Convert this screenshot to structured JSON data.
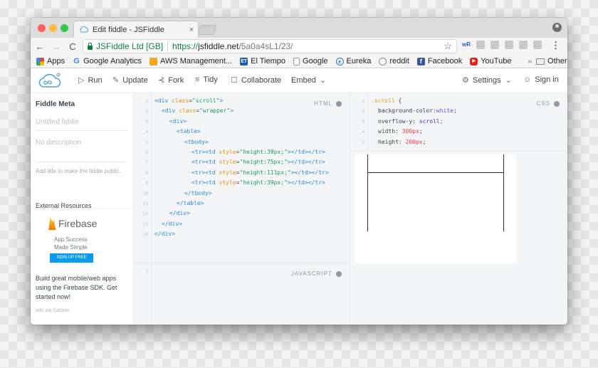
{
  "browser": {
    "tab_title": "Edit fiddle - JSFiddle",
    "tab_close": "×",
    "nav": {
      "back": "←",
      "forward": "→",
      "reload": "C"
    },
    "cert_label": "JSFiddle Ltd [GB]",
    "url": {
      "scheme": "https://",
      "host": "jsfiddle.net",
      "path": "/5a0a4sL1/23/"
    },
    "star": "☆",
    "menu": "⋮",
    "extensions": [
      "wR",
      "",
      "",
      "",
      "",
      ""
    ]
  },
  "bookmarks": [
    {
      "label": "Apps",
      "icon": "apps-icon"
    },
    {
      "label": "Google Analytics",
      "icon": "google-icon"
    },
    {
      "label": "AWS Management...",
      "icon": "aws-icon"
    },
    {
      "label": "El Tiempo",
      "icon": "el-tiempo-icon"
    },
    {
      "label": "Google",
      "icon": "document-icon"
    },
    {
      "label": "Eureka",
      "icon": "eureka-icon"
    },
    {
      "label": "reddit",
      "icon": "reddit-icon"
    },
    {
      "label": "Facebook",
      "icon": "facebook-icon"
    },
    {
      "label": "YouTube",
      "icon": "youtube-icon"
    }
  ],
  "bookmarks_overflow": "»",
  "other_bookmarks": "Other Bookmarks",
  "header": {
    "run": "Run",
    "update": "Update",
    "fork": "Fork",
    "tidy": "Tidy",
    "collaborate": "Collaborate",
    "embed": "Embed",
    "settings": "Settings",
    "sign_in": "Sign in"
  },
  "sidebar": {
    "title": "Fiddle Meta",
    "title_placeholder": "Untitled fiddle",
    "description_placeholder": "No description",
    "hint": "Add title to make the fiddle public.",
    "external_resources": "External Resources",
    "ad": {
      "brand": "Firebase",
      "tagline_1": "App Success",
      "tagline_2": "Made Simple",
      "cta": "SIGN UP FREE",
      "copy": "Build great mobile/web apps using the Firebase SDK. Get started now!",
      "via": "ads via Carbon"
    }
  },
  "editors": {
    "html": {
      "label": "HTML",
      "lines": [
        "1",
        "2",
        "3",
        "4",
        "5",
        "6",
        "7",
        "8",
        "9",
        "10",
        "11",
        "12",
        "13",
        "14"
      ]
    },
    "css": {
      "label": "CSS",
      "lines": [
        "1",
        "2",
        "3",
        "4",
        "5"
      ]
    },
    "js": {
      "label": "JAVASCRIPT",
      "lines": [
        "1"
      ]
    }
  },
  "code_html": {
    "l1": {
      "open": "<div ",
      "attr": "class",
      "eq": "=",
      "val": "\"scroll\"",
      "close": ">"
    },
    "l2": {
      "open": "<div ",
      "attr": "class",
      "eq": "=",
      "val": "\"wrapper\"",
      "close": ">"
    },
    "l3": "<div>",
    "l4": "<table>",
    "l5": "<tbody>",
    "rows": [
      {
        "pre": "<tr><td ",
        "attr": "style",
        "eq": "=",
        "val": "\"height:39px;\"",
        "post": "></td></tr>"
      },
      {
        "pre": "<tr><td ",
        "attr": "style",
        "eq": "=",
        "val": "\"height:75px;\"",
        "post": "></td></tr>"
      },
      {
        "pre": "<tr><td ",
        "attr": "style",
        "eq": "=",
        "val": "\"height:111px;\"",
        "post": "></td></tr>"
      },
      {
        "pre": "<tr><td ",
        "attr": "style",
        "eq": "=",
        "val": "\"height:39px;\"",
        "post": "></td></tr>"
      }
    ],
    "l10": "</tbody>",
    "l11": "</table>",
    "l12": "</div>",
    "l13": "</div>",
    "l14": "</div>"
  },
  "code_css": {
    "selector": ".scroll",
    "brace_open": " {",
    "p1": {
      "prop": "background-color:",
      "val": "white",
      "end": ";"
    },
    "p2": {
      "prop": "overflow-y: ",
      "val": "scroll",
      "end": ";"
    },
    "p3": {
      "prop": "width: ",
      "val": "300px",
      "end": ";"
    },
    "p4": {
      "prop": "height: ",
      "val": "200px",
      "end": ";"
    }
  },
  "colors": {
    "accent": "#0b9bee",
    "secure_green": "#0b8043",
    "tag_blue": "#2b8bd8",
    "attr_orange": "#e8920e",
    "string_green": "#1e9a6a",
    "number_red": "#e63a4b"
  }
}
